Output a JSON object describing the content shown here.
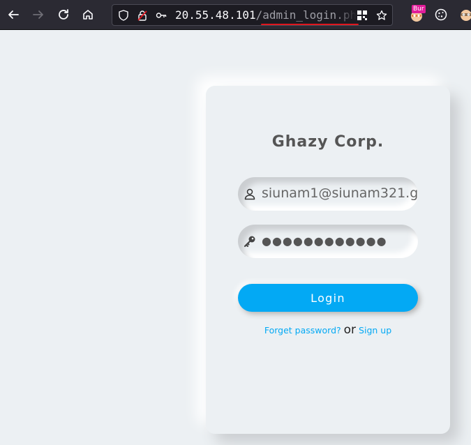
{
  "browser": {
    "url_host": "20.55.48.101",
    "url_path": "/admin_login.ph",
    "extension_badge": "Bur",
    "colors": {
      "toolbar": "#2b2a33",
      "urlbar": "#1c1b22",
      "underline": "#e0161e"
    },
    "icons": [
      "back-icon",
      "forward-icon",
      "reload-icon",
      "home-icon",
      "shield-icon",
      "insecure-lock-icon",
      "key-icon",
      "qr-code-icon",
      "bookmark-star-icon",
      "burp-extension-icon",
      "cookie-icon",
      "extension-icon"
    ]
  },
  "login": {
    "brand": "Ghazy Corp.",
    "email_value": "siunam1@siunam321.g",
    "password_value": "●●●●●●●●●●●●",
    "login_label": "Login",
    "forgot_label": "Forget password?",
    "or_label": "or",
    "signup_label": "Sign up",
    "colors": {
      "background": "#ecf0f3",
      "accent": "#03a9f4",
      "text": "#555555"
    }
  }
}
